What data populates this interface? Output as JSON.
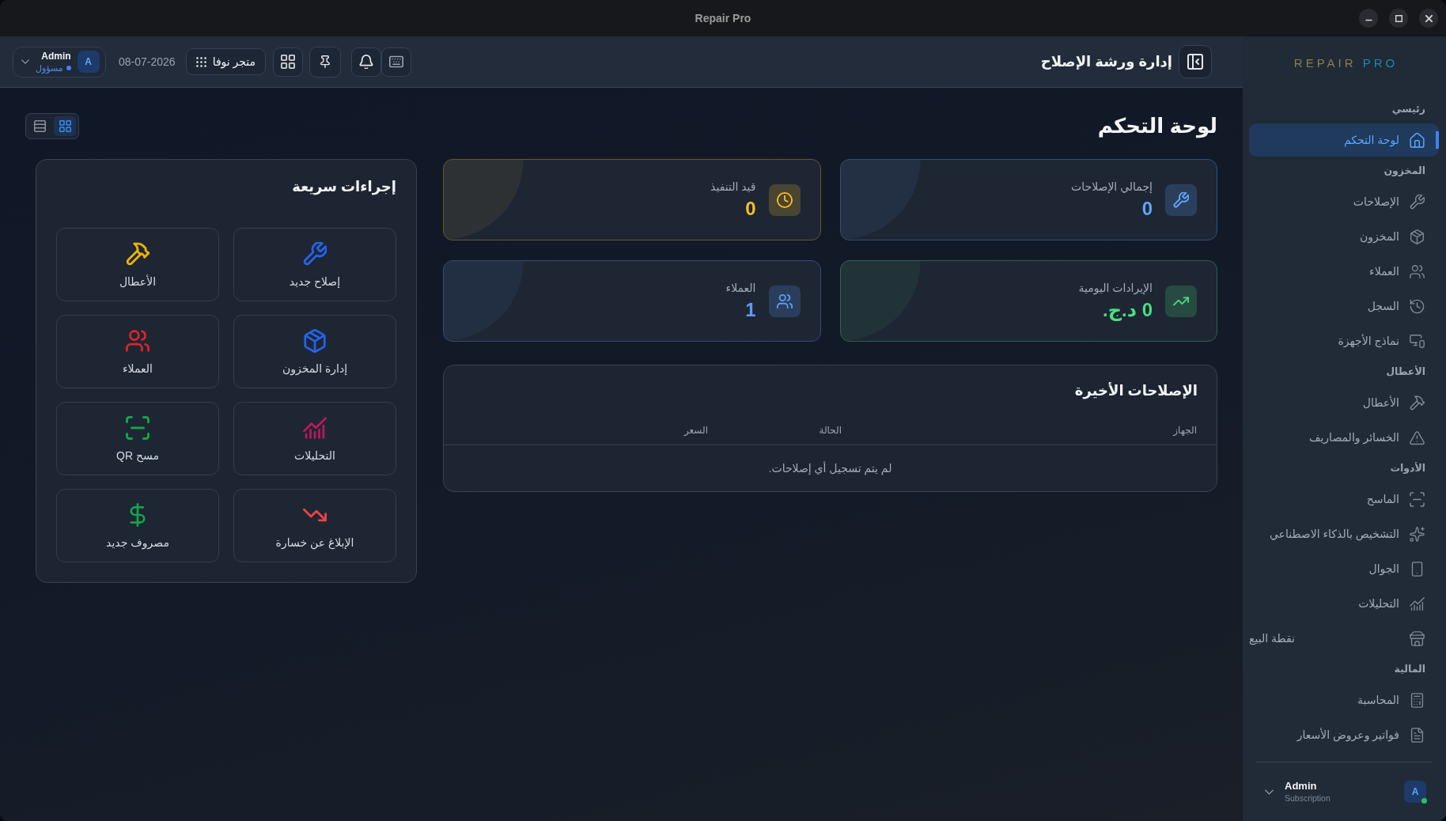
{
  "window": {
    "title": "Repair Pro"
  },
  "sidebar": {
    "logo": {
      "primary": "REPAIR",
      "secondary": "PRO"
    },
    "sections": [
      {
        "title": "رئيسي",
        "items": [
          {
            "label": "لوحة التحكم",
            "kind": "nav",
            "selected": true
          }
        ]
      },
      {
        "title": "المخزون",
        "items": [
          {
            "label": "الإصلاحات",
            "kind": "nav",
            "selected": false
          },
          {
            "label": "المخزون",
            "kind": "nav",
            "selected": false
          },
          {
            "label": "العملاء",
            "kind": "nav",
            "selected": false
          },
          {
            "label": "السجل",
            "kind": "nav",
            "selected": false
          },
          {
            "label": "نماذج الأجهزة",
            "kind": "nav",
            "selected": false
          }
        ]
      },
      {
        "title": "الأعطال",
        "items": [
          {
            "label": "الأعطال",
            "kind": "nav",
            "selected": false
          },
          {
            "label": "الخسائر والمصاريف",
            "kind": "nav",
            "selected": false
          }
        ]
      },
      {
        "title": "الأدوات",
        "items": [
          {
            "label": "الماسح",
            "kind": "nav",
            "selected": false
          },
          {
            "label": "التشخيص بالذكاء الاصطناعي",
            "kind": "nav",
            "selected": false
          },
          {
            "label": "الجوال",
            "kind": "nav",
            "selected": false
          },
          {
            "label": "التحليلات",
            "kind": "nav",
            "selected": false
          },
          {
            "label": "نقطة البيع",
            "kind": "split",
            "selected": false
          }
        ]
      },
      {
        "title": "المالية",
        "items": [
          {
            "label": "المحاسبة",
            "kind": "nav",
            "selected": false
          },
          {
            "label": "فواتير وعروض الأسعار",
            "kind": "nav",
            "selected": false
          }
        ]
      }
    ],
    "user": {
      "name": "Admin",
      "plan": "Subscription",
      "initial": "A",
      "online": true
    }
  },
  "topbar": {
    "title": "إدارة ورشة الإصلاح",
    "user": {
      "name": "Admin",
      "role": "مسؤول",
      "initial": "A",
      "online": true
    },
    "date": "08-07-2026",
    "store_button": "متجر نوفا"
  },
  "page_title": "لوحة التحكم",
  "view_modes": [
    {
      "selected": false
    },
    {
      "selected": true
    }
  ],
  "stats": [
    {
      "label": "إجمالي الإصلاحات",
      "value": "0",
      "color": "#60a5fa"
    },
    {
      "label": "قيد التنفيذ",
      "value": "0",
      "color": "#fbbf24"
    },
    {
      "label": "الإيرادات اليومية",
      "value": "0 د.ج.",
      "color": "#4ade80"
    },
    {
      "label": "العملاء",
      "value": "1",
      "color": "#5b9cf6"
    }
  ],
  "recent_repairs": {
    "title": "الإصلاحات الأخيرة",
    "columns": [
      "الجهاز",
      "الحالة",
      "السعر"
    ],
    "empty_message": "لم يتم تسجيل أي إصلاحات."
  },
  "quick_actions": {
    "title": "إجراءات سريعة",
    "items": [
      {
        "label": "إصلاح جديد",
        "color": "#2563eb"
      },
      {
        "label": "الأعطال",
        "color": "#eab308"
      },
      {
        "label": "إدارة المخزون",
        "color": "#2563eb"
      },
      {
        "label": "العملاء",
        "color": "#dc2626"
      },
      {
        "label": "التحليلات",
        "color": "#be185d"
      },
      {
        "label": "مسح QR",
        "color": "#16a34a"
      },
      {
        "label": "الإبلاغ عن خسارة",
        "color": "#ef4444"
      },
      {
        "label": "مصروف جديد",
        "color": "#16a34a"
      }
    ]
  }
}
